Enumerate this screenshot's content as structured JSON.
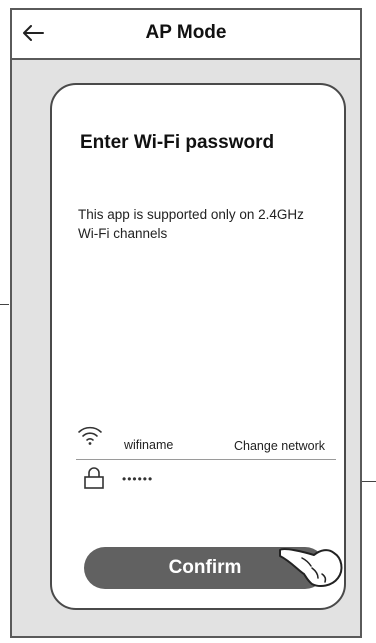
{
  "header": {
    "title": "AP Mode",
    "back_icon": "arrow-left-icon"
  },
  "card": {
    "heading": "Enter Wi-Fi password",
    "description": "This app is supported only on 2.4GHz Wi-Fi channels"
  },
  "network": {
    "wifi_icon": "wifi-icon",
    "name": "wifiname",
    "change_label": "Change network"
  },
  "password": {
    "lock_icon": "lock-icon",
    "value": "••••••"
  },
  "confirm": {
    "label": "Confirm"
  },
  "colors": {
    "button": "#616161",
    "frame_bg": "#e2e2e2",
    "border": "#4a4a4a"
  }
}
